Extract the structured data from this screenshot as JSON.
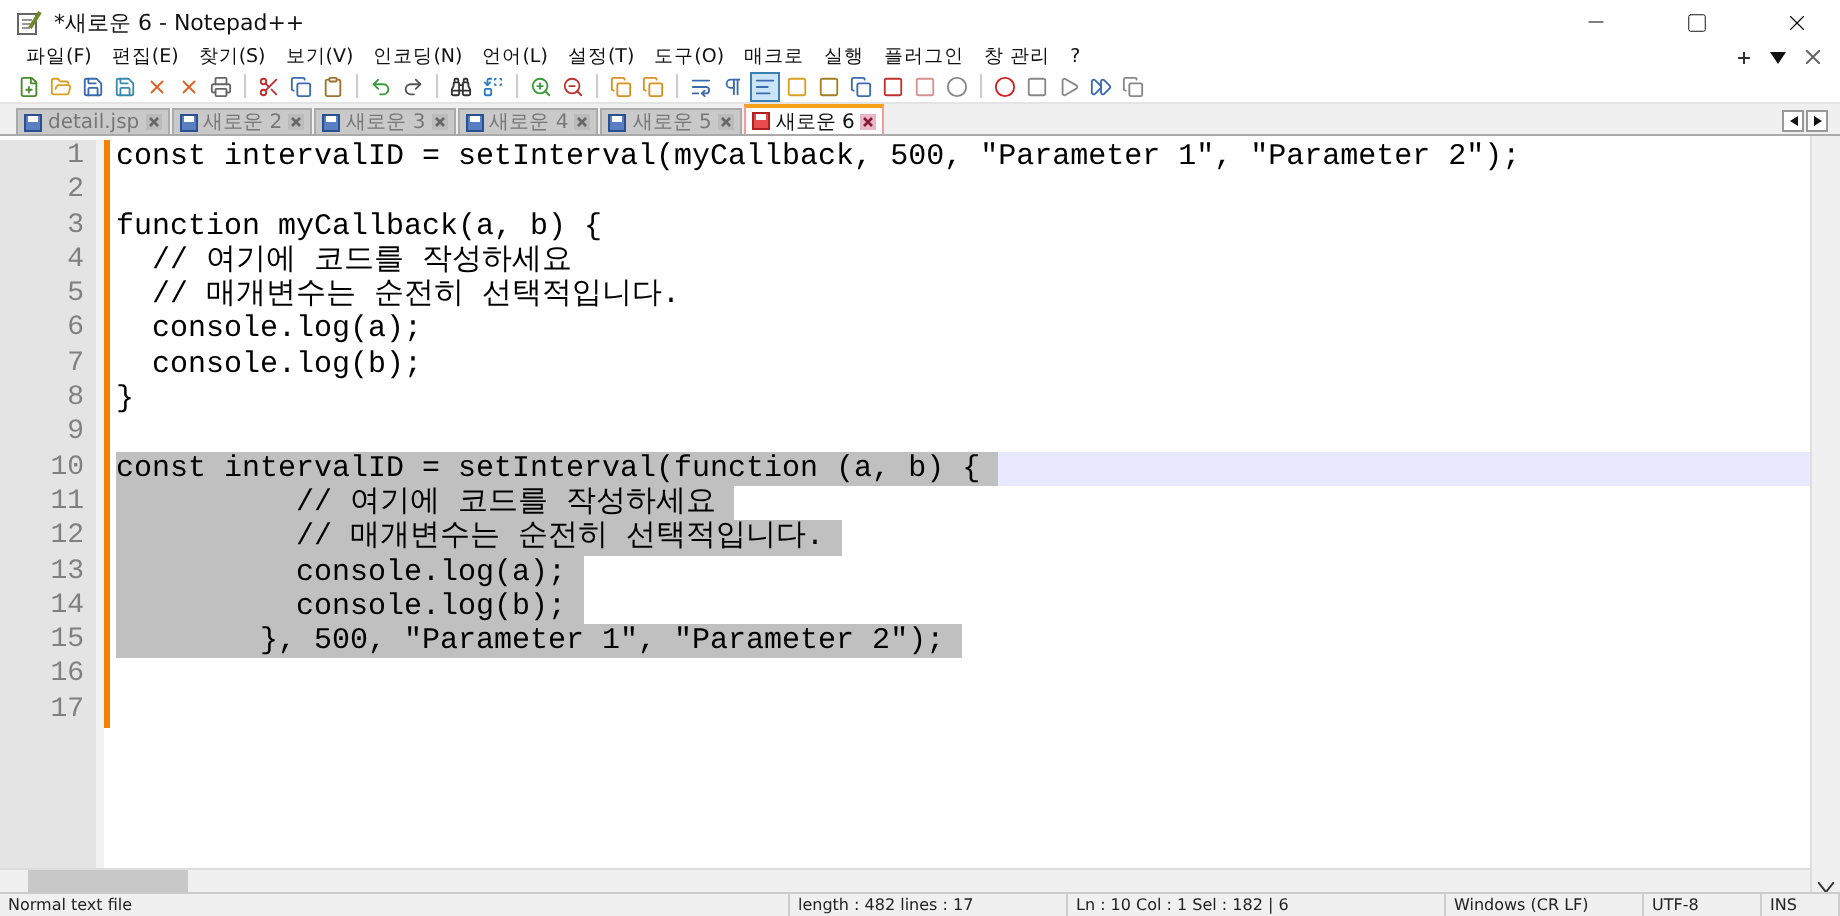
{
  "window": {
    "title": "*새로운 6 - Notepad++"
  },
  "menu": [
    "파일(F)",
    "편집(E)",
    "찾기(S)",
    "보기(V)",
    "인코딩(N)",
    "언어(L)",
    "설정(T)",
    "도구(O)",
    "매크로",
    "실행",
    "플러그인",
    "창 관리",
    "?"
  ],
  "tabs": [
    {
      "label": "detail.jsp",
      "selected": false,
      "modified": false
    },
    {
      "label": "새로운 2",
      "selected": false,
      "modified": false
    },
    {
      "label": "새로운 3",
      "selected": false,
      "modified": false
    },
    {
      "label": "새로운 4",
      "selected": false,
      "modified": false
    },
    {
      "label": "새로운 5",
      "selected": false,
      "modified": false
    },
    {
      "label": "새로운 6",
      "selected": true,
      "modified": true
    }
  ],
  "editor": {
    "lines": [
      {
        "number": "1",
        "text": "const intervalID = setInterval(myCallback, 500, \"Parameter 1\", \"Parameter 2\");",
        "selected": false,
        "current": false
      },
      {
        "number": "2",
        "selected": false,
        "current": false
      },
      {
        "number": "3",
        "text": "function myCallback(a, b) {",
        "selected": false,
        "current": false
      },
      {
        "number": "4",
        "text": "  // 여기에 코드를 작성하세요",
        "selected": false,
        "current": false
      },
      {
        "number": "5",
        "text": "  // 매개변수는 순전히 선택적입니다.",
        "selected": false,
        "current": false
      },
      {
        "number": "6",
        "text": "  console.log(a);",
        "selected": false,
        "current": false
      },
      {
        "number": "7",
        "text": "  console.log(b);",
        "selected": false,
        "current": false
      },
      {
        "number": "8",
        "text": "}",
        "selected": false,
        "current": false
      },
      {
        "number": "9",
        "selected": false,
        "current": false
      },
      {
        "number": "10",
        "text": "const intervalID = setInterval(function (a, b) {",
        "selected": true,
        "current": true
      },
      {
        "number": "11",
        "text": "          // 여기에 코드를 작성하세요",
        "selected": true,
        "current": false
      },
      {
        "number": "12",
        "text": "          // 매개변수는 순전히 선택적입니다.",
        "selected": true,
        "current": false
      },
      {
        "number": "13",
        "text": "          console.log(a);",
        "selected": true,
        "current": false
      },
      {
        "number": "14",
        "text": "          console.log(b);",
        "selected": true,
        "current": false
      },
      {
        "number": "15",
        "text": "        }, 500, \"Parameter 1\", \"Parameter 2\");",
        "selected": true,
        "current": false
      },
      {
        "number": "16",
        "selected": false,
        "current": false
      },
      {
        "number": "17",
        "selected": false,
        "current": false
      }
    ]
  },
  "status_bar": [
    "Normal text file",
    "length : 482    lines : 17",
    "Ln : 10    Col : 1    Sel : 182 | 6",
    "Windows (CR LF)",
    "UTF-8",
    "INS"
  ]
}
